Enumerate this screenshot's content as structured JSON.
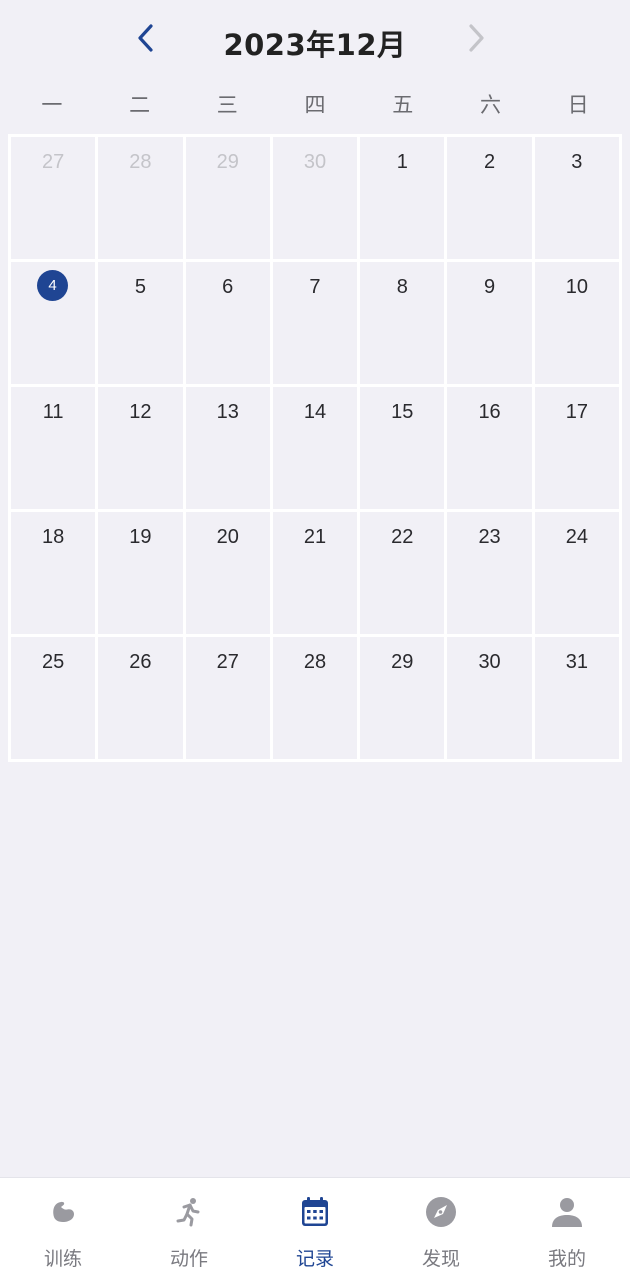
{
  "header": {
    "title": "2023年12月",
    "prev_icon": "chevron-left-icon",
    "next_icon": "chevron-right-icon"
  },
  "weekdays": [
    "一",
    "二",
    "三",
    "四",
    "五",
    "六",
    "日"
  ],
  "calendar": {
    "today": "4",
    "weeks": [
      [
        {
          "day": "27",
          "other": true
        },
        {
          "day": "28",
          "other": true
        },
        {
          "day": "29",
          "other": true
        },
        {
          "day": "30",
          "other": true
        },
        {
          "day": "1"
        },
        {
          "day": "2"
        },
        {
          "day": "3"
        }
      ],
      [
        {
          "day": "4",
          "today": true
        },
        {
          "day": "5"
        },
        {
          "day": "6"
        },
        {
          "day": "7"
        },
        {
          "day": "8"
        },
        {
          "day": "9"
        },
        {
          "day": "10"
        }
      ],
      [
        {
          "day": "11"
        },
        {
          "day": "12"
        },
        {
          "day": "13"
        },
        {
          "day": "14"
        },
        {
          "day": "15"
        },
        {
          "day": "16"
        },
        {
          "day": "17"
        }
      ],
      [
        {
          "day": "18"
        },
        {
          "day": "19"
        },
        {
          "day": "20"
        },
        {
          "day": "21"
        },
        {
          "day": "22"
        },
        {
          "day": "23"
        },
        {
          "day": "24"
        }
      ],
      [
        {
          "day": "25"
        },
        {
          "day": "26"
        },
        {
          "day": "27"
        },
        {
          "day": "28"
        },
        {
          "day": "29"
        },
        {
          "day": "30"
        },
        {
          "day": "31"
        }
      ]
    ]
  },
  "tabs": [
    {
      "label": "训练",
      "icon": "muscle-arm-icon",
      "active": false
    },
    {
      "label": "动作",
      "icon": "running-person-icon",
      "active": false
    },
    {
      "label": "记录",
      "icon": "calendar-icon",
      "active": true
    },
    {
      "label": "发现",
      "icon": "compass-icon",
      "active": false
    },
    {
      "label": "我的",
      "icon": "person-icon",
      "active": false
    }
  ],
  "colors": {
    "accent": "#1f4593",
    "background": "#f1f0f6",
    "inactive": "#9a9aa0",
    "muted_day": "#c4c4c9"
  }
}
